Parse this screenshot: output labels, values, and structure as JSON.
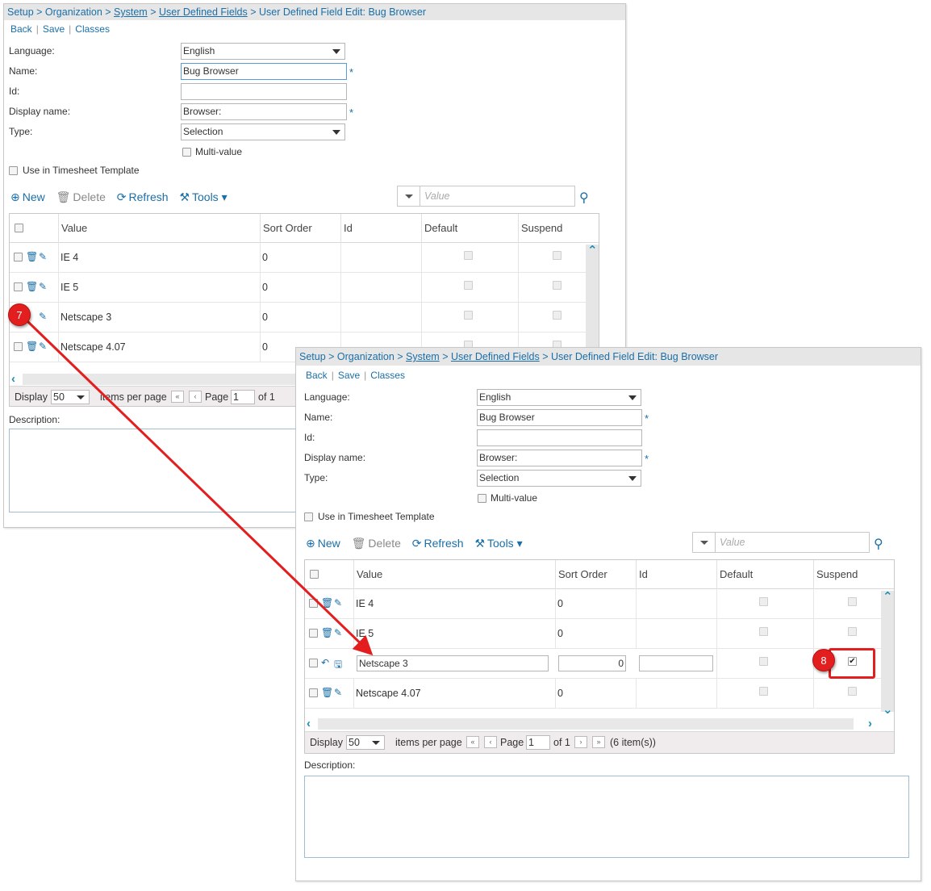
{
  "breadcrumb": {
    "setup": "Setup",
    "sep1": " > ",
    "organization": "Organization",
    "sep2": " > ",
    "system": "System",
    "sep3": " > ",
    "udf": "User Defined Fields",
    "sep4": " > ",
    "current": "User Defined Field Edit: Bug Browser"
  },
  "actions": {
    "back": "Back",
    "save": "Save",
    "classes": "Classes",
    "divider": "|"
  },
  "form": {
    "language_label": "Language:",
    "language_value": "English",
    "name_label": "Name:",
    "name_value": "Bug Browser",
    "id_label": "Id:",
    "id_value": "",
    "display_label": "Display name:",
    "display_value": "Browser:",
    "type_label": "Type:",
    "type_value": "Selection",
    "multivalue_label": "Multi-value",
    "timesheet_label": "Use in Timesheet Template",
    "required_mark": "*"
  },
  "toolbar": {
    "new": "New",
    "delete": "Delete",
    "refresh": "Refresh",
    "tools": "Tools",
    "search_placeholder": "Value"
  },
  "grid": {
    "columns": [
      "Value",
      "Sort Order",
      "Id",
      "Default",
      "Suspend"
    ],
    "rows": [
      {
        "value": "IE 4",
        "sort": "0"
      },
      {
        "value": "IE 5",
        "sort": "0"
      },
      {
        "value": "Netscape 3",
        "sort": "0"
      },
      {
        "value": "Netscape 4.07",
        "sort": "0"
      }
    ]
  },
  "pager": {
    "display_label": "Display",
    "display_value": "50",
    "per_page": "items per page",
    "page_label": "Page",
    "page_value": "1",
    "of_label": "of 1",
    "count": "(6 item(s))"
  },
  "description_label": "Description:",
  "callouts": {
    "step7": "7",
    "step8": "8"
  },
  "colors": {
    "link": "#1a6fa8",
    "callout": "#e31e1e",
    "header_bg": "#e6e6e6"
  }
}
